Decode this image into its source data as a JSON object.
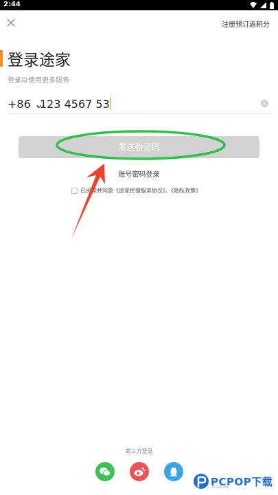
{
  "status_bar": {
    "time": "2:44"
  },
  "header": {
    "top_link": "注册预订返积分"
  },
  "login": {
    "title": "登录途家",
    "subtitle": "登录以使用更多服务",
    "country_code": "+86 ⌄",
    "phone": "123 4567 53",
    "send_code_label": "发送验证码",
    "account_login_label": "账号密码登录",
    "agreement_text": "已阅读并同意《途家民宿服务协议》、《隐私政策》"
  },
  "third_party": {
    "label": "第三方登录",
    "providers": [
      "wechat",
      "weibo",
      "qq"
    ]
  },
  "watermark": {
    "brand": "PCPOP下载",
    "sub": "PCPOP.COM"
  },
  "colors": {
    "accent": "#ff8a1f",
    "button_disabled": "#d2d2d2",
    "annotation_ellipse": "#2fbf4a",
    "annotation_arrow": "#e8452c",
    "wechat": "#3fc05a",
    "weibo": "#e8545a",
    "qq": "#3ba3e0"
  }
}
